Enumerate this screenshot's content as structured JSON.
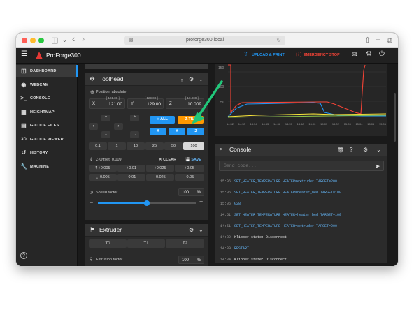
{
  "browser": {
    "url": "proforge300.local"
  },
  "app": {
    "title": "ProForge300",
    "upload_label": "UPLOAD & PRINT",
    "estop_label": "EMERGENCY STOP"
  },
  "sidebar": {
    "items": [
      {
        "label": "DASHBOARD",
        "icon": "dashboard-icon",
        "active": true
      },
      {
        "label": "WEBCAM",
        "icon": "webcam-icon"
      },
      {
        "label": "CONSOLE",
        "icon": "console-icon"
      },
      {
        "label": "HEIGHTMAP",
        "icon": "grid-icon"
      },
      {
        "label": "G-CODE FILES",
        "icon": "folder-icon"
      },
      {
        "label": "G-CODE VIEWER",
        "icon": "3d-icon"
      },
      {
        "label": "HISTORY",
        "icon": "history-icon"
      },
      {
        "label": "MACHINE",
        "icon": "wrench-icon"
      }
    ]
  },
  "toolhead": {
    "title": "Toolhead",
    "position_label": "Position: absolute",
    "axes": [
      {
        "axis": "X",
        "value": "121.00",
        "target": "[ 121.00 ]"
      },
      {
        "axis": "Y",
        "value": "129.00",
        "target": "[ 129.00 ]"
      },
      {
        "axis": "Z",
        "value": "10.009",
        "target": "[ 10.009 ]"
      }
    ],
    "home_all": "ALL",
    "ztilt": "Z-TILT",
    "home_x": "X",
    "home_y": "Y",
    "home_z": "Z",
    "steps": [
      "0.1",
      "1",
      "10",
      "25",
      "50",
      "100"
    ],
    "zoffset_label": "Z-Offset: 0.009",
    "clear_label": "CLEAR",
    "save_label": "SAVE",
    "zoff_buttons": [
      "+0.005",
      "+0.01",
      "+0.025",
      "+0.05",
      "-0.005",
      "-0.01",
      "-0.025",
      "-0.05"
    ],
    "speed_label": "Speed factor",
    "speed_value": "100",
    "speed_unit": "%",
    "speed_fraction": 0.5
  },
  "extruder": {
    "title": "Extruder",
    "tools": [
      "T0",
      "T1",
      "T2"
    ],
    "flow_label": "Extrusion factor",
    "flow_value": "100",
    "flow_unit": "%"
  },
  "chart": {
    "yticks": [
      "150",
      "100",
      "50"
    ],
    "xticks": [
      "14:52",
      "14:53",
      "14:54",
      "14:55",
      "14:56",
      "14:57",
      "14:58",
      "15:00",
      "15:01",
      "15:02",
      "15:03",
      "15:04",
      "15:05",
      "15:06"
    ]
  },
  "console": {
    "title": "Console",
    "placeholder": "Send code...",
    "entries": [
      {
        "time": "15:06",
        "text": "SET_HEATER_TEMPERATURE HEATER=extruder TARGET=200",
        "type": "cmd"
      },
      {
        "time": "15:06",
        "text": "SET_HEATER_TEMPERATURE HEATER=heater_bed TARGET=100",
        "type": "cmd"
      },
      {
        "time": "15:06",
        "text": "G28",
        "type": "cmd"
      },
      {
        "time": "14:51",
        "text": "SET_HEATER_TEMPERATURE HEATER=heater_bed TARGET=100",
        "type": "cmd"
      },
      {
        "time": "14:51",
        "text": "SET_HEATER_TEMPERATURE HEATER=extruder TARGET=200",
        "type": "cmd"
      },
      {
        "time": "14:39",
        "text": "Klipper state: Disconnect",
        "type": "resp"
      },
      {
        "time": "14:39",
        "text": "RESTART",
        "type": "cmd"
      },
      {
        "time": "14:34",
        "text": "Klipper state: Disconnect",
        "type": "resp"
      }
    ]
  },
  "colors": {
    "accent_blue": "#2196f3",
    "ztilt_orange": "#ff9800",
    "estop_red": "#f44336",
    "cmd_blue": "#64b5f6",
    "highlight_green": "#21c77a"
  }
}
